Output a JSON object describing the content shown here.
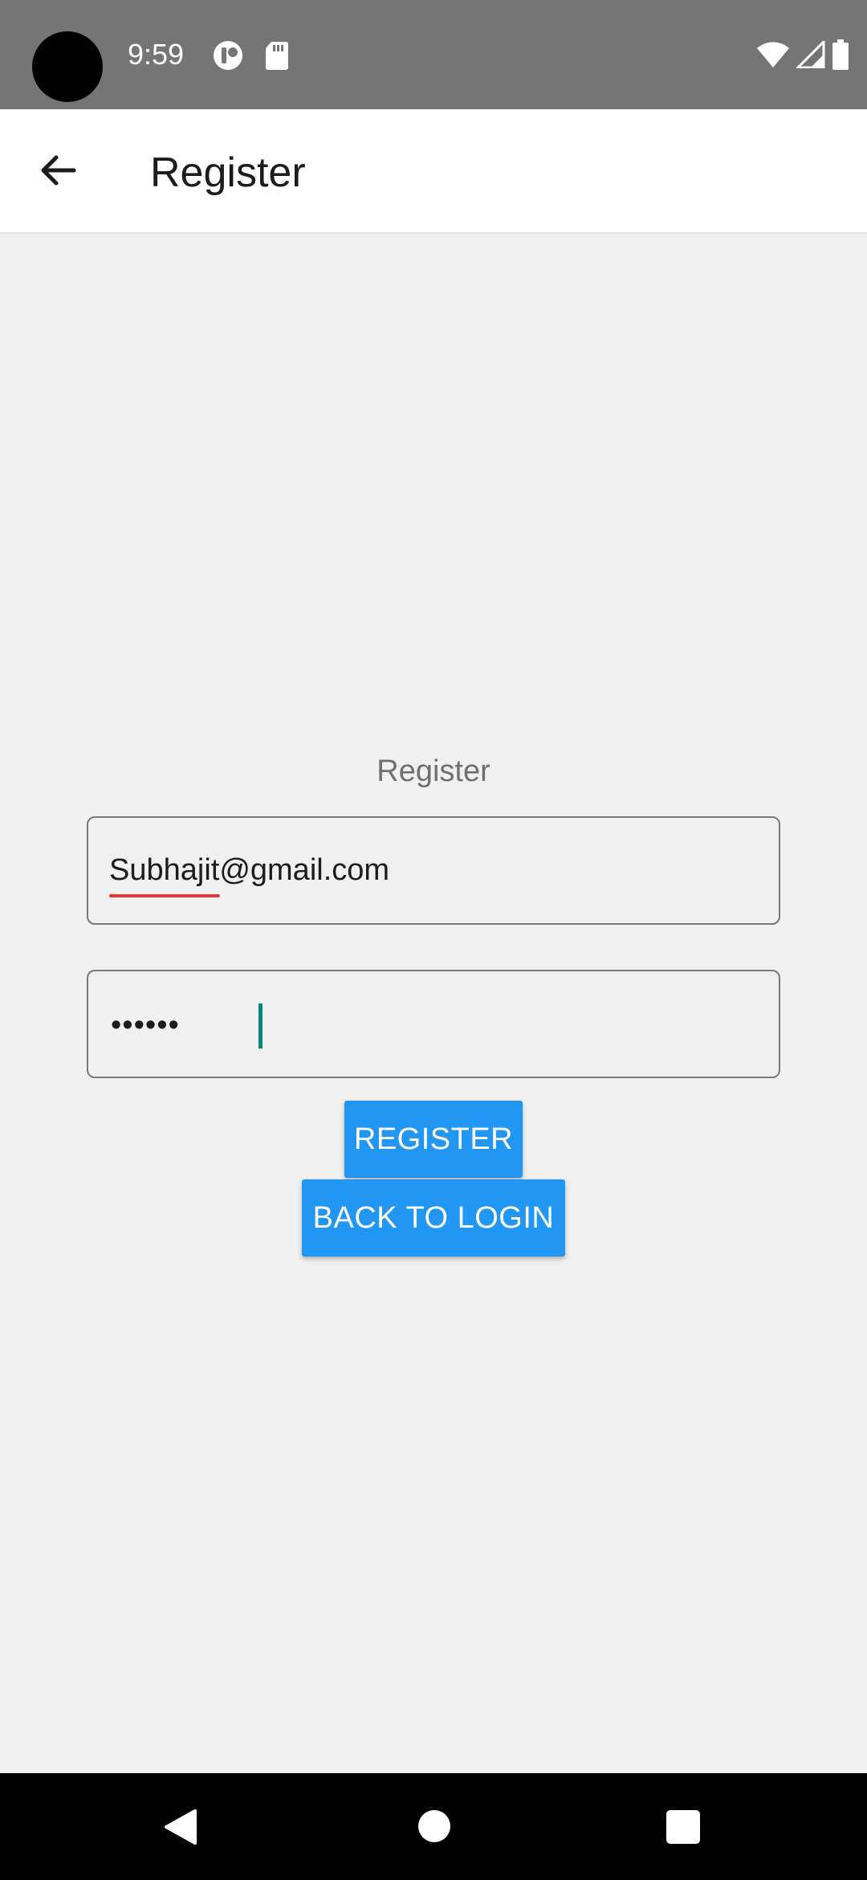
{
  "status_bar": {
    "time": "9:59",
    "icons": [
      "camera-cutout",
      "notification-icon",
      "sd-card-icon",
      "wifi-icon",
      "signal-icon",
      "battery-icon"
    ]
  },
  "app_bar": {
    "title": "Register",
    "back_icon": "arrow-back-icon"
  },
  "form": {
    "heading": "Register",
    "email_value": "Subhajit@gmail.com",
    "password_value": "••••••",
    "register_label": "REGISTER",
    "back_to_login_label": "BACK TO LOGIN"
  },
  "nav_bar": {
    "icons": [
      "nav-back-icon",
      "nav-home-icon",
      "nav-recents-icon"
    ]
  },
  "colors": {
    "accent": "#2196f3",
    "status_bar": "#757575",
    "background": "#f0f0f0",
    "cursor": "#00897b",
    "spellcheck": "#e53935"
  }
}
